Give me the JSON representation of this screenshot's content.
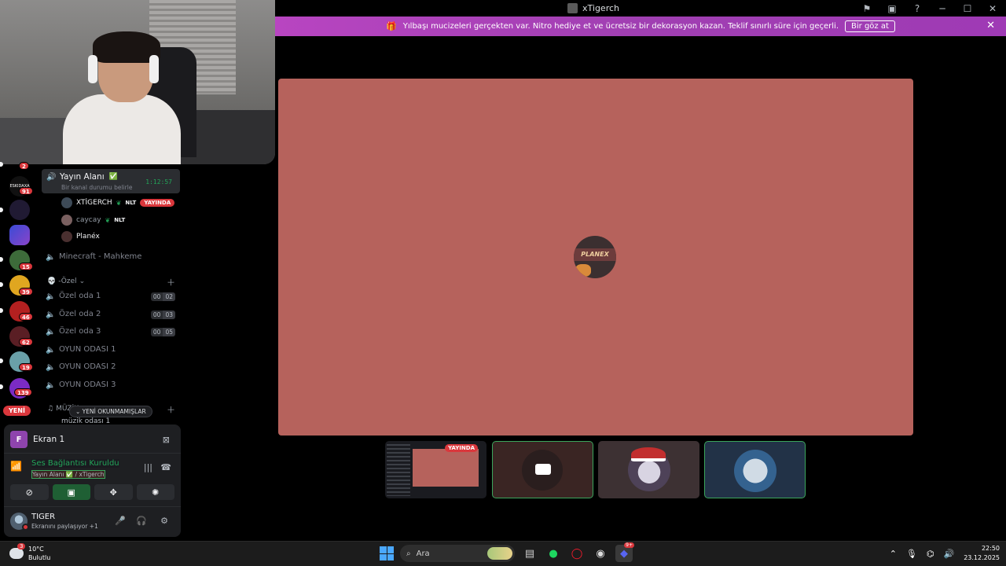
{
  "window": {
    "title": "xTigerch"
  },
  "banner": {
    "text": "Yılbaşı mucizeleri gerçekten var. Nitro hediye et ve ücretsiz bir dekorasyon kazan. Teklif sınırlı süre için geçerli.",
    "cta": "Bir göz at"
  },
  "rail": {
    "badges": [
      "2",
      "91",
      "15",
      "39",
      "46",
      "62",
      "19",
      "139"
    ],
    "new_label": "YENİ",
    "server_label": "ESKIDAXA"
  },
  "voice": {
    "active_channel": "Yayın Alanı",
    "active_sub": "Bir kanal durumu belirle",
    "timer": "1:12:57",
    "members": [
      {
        "name": "XTİGERCH",
        "tag": "NLT",
        "badge": "YAYINDA"
      },
      {
        "name": "caycay",
        "tag": "NLT"
      },
      {
        "name": "Planéx"
      }
    ],
    "minecraft": "Minecraft - Mahkeme",
    "category_ozel": "-Özel",
    "rooms": [
      {
        "name": "Özel oda 1",
        "a": "00",
        "b": "02"
      },
      {
        "name": "Özel oda 2",
        "a": "00",
        "b": "03"
      },
      {
        "name": "Özel oda 3",
        "a": "00",
        "b": "05"
      },
      {
        "name": "OYUN ODASI 1"
      },
      {
        "name": "OYUN ODASI 2"
      },
      {
        "name": "OYUN ODASI 3"
      }
    ],
    "category_muzik": "MÜZİK",
    "unread_pill": "YENİ OKUNMAMIŞLAR",
    "partial_channel": "müzik odası 1"
  },
  "panel": {
    "stream_letter": "F",
    "stream_title": "Ekran 1",
    "rtc_title": "Ses Bağlantısı Kuruldu",
    "rtc_sub": "Yayın Alanı ✅ / xTigerch",
    "user_name": "TIGER",
    "user_sub": "Ekranını paylaşıyor +1"
  },
  "stage": {
    "avatar_text": "PLANEX"
  },
  "thumbs": {
    "live_label": "YAYINDA"
  },
  "taskbar": {
    "temp": "10°C",
    "weather": "Bulutlu",
    "weather_badge": "3",
    "search": "Ara",
    "time": "22:50",
    "date": "23.12.2025",
    "discord_badge": "9+"
  }
}
